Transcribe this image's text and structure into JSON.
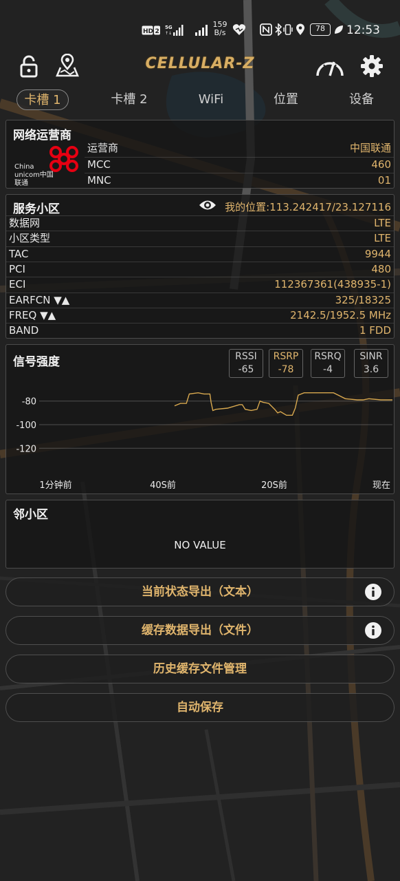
{
  "status_bar": {
    "left_icons": [
      "hd-icon",
      "sim2-icon",
      "5g-signal-icon",
      "signal-icon"
    ],
    "net_speed_value": "159",
    "net_speed_unit": "B/s",
    "battery": "78",
    "time": "12:53"
  },
  "header": {
    "logo": "CELLULAR-Z",
    "left_icons": [
      "lock-icon",
      "map-pin-icon"
    ],
    "right_icons": [
      "speedometer-icon",
      "gear-icon"
    ]
  },
  "tabs": [
    {
      "label": "卡槽 1",
      "active": true
    },
    {
      "label": "卡槽 2",
      "active": false
    },
    {
      "label": "WiFi",
      "active": false
    },
    {
      "label": "位置",
      "active": false
    },
    {
      "label": "设备",
      "active": false
    }
  ],
  "operator": {
    "title": "网络运营商",
    "logo_text": "China unicom中国联通",
    "rows": [
      {
        "key": "运营商",
        "value": "中国联通"
      },
      {
        "key": "MCC",
        "value": "460"
      },
      {
        "key": "MNC",
        "value": "01"
      }
    ]
  },
  "serving_cell": {
    "title": "服务小区",
    "location": "我的位置:113.242417/23.127116",
    "rows": [
      {
        "key": "数据网",
        "value": "LTE"
      },
      {
        "key": "小区类型",
        "value": "LTE"
      },
      {
        "key": "TAC",
        "value": "9944"
      },
      {
        "key": "PCI",
        "value": "480"
      },
      {
        "key": "ECI",
        "value": "112367361(438935-1)"
      },
      {
        "key": "EARFCN ▼▲",
        "value": "325/18325"
      },
      {
        "key": "FREQ ▼▲",
        "value": "2142.5/1952.5 MHz"
      },
      {
        "key": "BAND",
        "value": "1 FDD"
      }
    ]
  },
  "signal": {
    "title": "信号强度",
    "metrics": [
      {
        "name": "RSSI",
        "value": "-65",
        "active": false
      },
      {
        "name": "RSRP",
        "value": "-78",
        "active": true
      },
      {
        "name": "RSRQ",
        "value": "-4",
        "active": false
      },
      {
        "name": "SINR",
        "value": "3.6",
        "active": false
      }
    ]
  },
  "chart_data": {
    "type": "line",
    "title": "",
    "xlabel": "",
    "ylabel": "",
    "x_ticks": [
      "1分钟前",
      "40S前",
      "20S前",
      "现在"
    ],
    "y_ticks": [
      -80,
      -100,
      -120
    ],
    "ylim": [
      -135,
      -65
    ],
    "xlim": [
      60,
      0
    ],
    "grid": true,
    "series": [
      {
        "values_x": [
          37,
          36,
          35,
          34.5,
          33,
          32,
          31,
          30.8,
          30.5,
          30,
          28,
          26,
          25.5,
          25,
          24,
          23,
          22.5,
          22,
          21,
          20,
          19.5,
          19,
          18,
          17,
          16.5,
          16,
          15,
          14,
          12,
          10,
          8,
          6,
          5,
          4,
          2,
          0
        ],
        "values_y": [
          -84,
          -82,
          -82,
          -74,
          -73,
          -74,
          -74,
          -81,
          -88,
          -87,
          -86,
          -83,
          -83,
          -87,
          -88,
          -87,
          -80,
          -81,
          -82,
          -87,
          -90,
          -89,
          -92,
          -92,
          -86,
          -75,
          -73,
          -73,
          -73,
          -73,
          -78,
          -79,
          -79,
          -78,
          -79,
          -79
        ]
      }
    ]
  },
  "neighbor": {
    "title": "邻小区",
    "empty_text": "NO VALUE"
  },
  "actions": [
    {
      "label": "当前状态导出（文本）",
      "info": true
    },
    {
      "label": "缓存数据导出（文件）",
      "info": true
    },
    {
      "label": "历史缓存文件管理",
      "info": false
    },
    {
      "label": "自动保存",
      "info": false
    }
  ],
  "colors": {
    "accent": "#e0b56d",
    "chart_line": "#d9a94f",
    "background": "#1f1f1f",
    "unicom_red": "#e60012"
  }
}
